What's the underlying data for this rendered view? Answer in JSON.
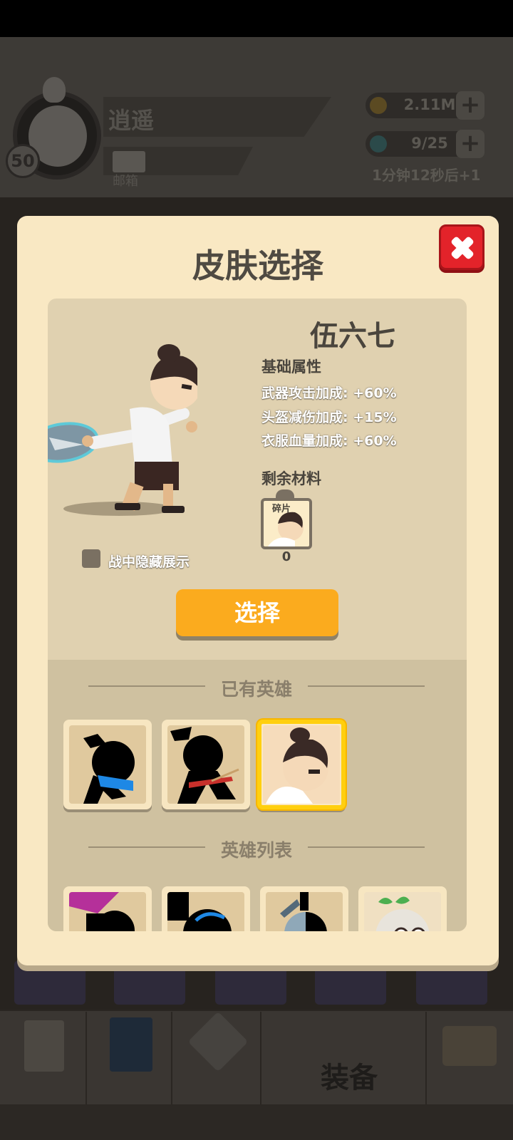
{
  "header": {
    "player_name": "逍遥",
    "level": "50",
    "mail_label": "邮箱",
    "gold": "2.11M",
    "energy": "9/25",
    "energy_timer": "1分钟12秒后+1",
    "plus": "+"
  },
  "bottom_nav": {
    "equip_label": "装备"
  },
  "modal": {
    "title": "皮肤选择",
    "hero": {
      "name": "伍六七",
      "base_attr_title": "基础属性",
      "stats": [
        "武器攻击加成: +60%",
        "头盔减伤加成: +15%",
        "衣服血量加成: +60%"
      ],
      "material_title": "剩余材料",
      "material_tag": "碎片",
      "material_count": "0",
      "hide_in_battle": "战中隐藏展示"
    },
    "select_button": "选择",
    "owned_title": "已有英雄",
    "list_title": "英雄列表",
    "selected_index": 2
  },
  "colors": {
    "modal_bg": "#f9e8c3",
    "panel_bg": "#e0d1b0",
    "button_orange": "#fbab1e",
    "close_red": "#e3232a",
    "selected_border": "#ffcf0f"
  }
}
